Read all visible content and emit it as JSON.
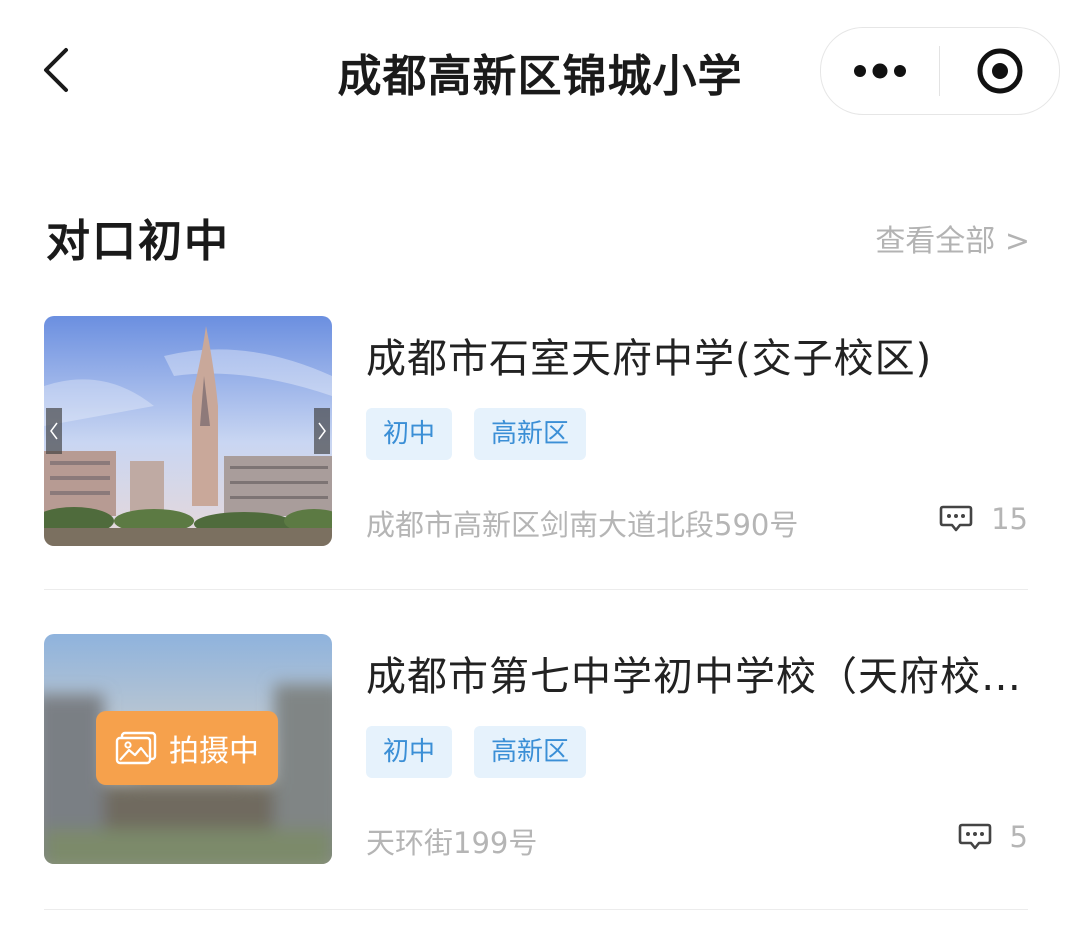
{
  "header": {
    "title": "成都高新区锦城小学",
    "back_icon": "chevron-left-icon",
    "more_icon": "more-dots-icon",
    "target_icon": "target-icon"
  },
  "section": {
    "title": "对口初中",
    "view_all": "查看全部 >"
  },
  "schools": [
    {
      "name": "成都市石室天府中学(交子校区)",
      "tags": [
        "初中",
        "高新区"
      ],
      "address": "成都市高新区剑南大道北段590号",
      "comment_count": "15",
      "photo": "campus-photo"
    },
    {
      "name": "成都市第七中学初中学校（天府校区）",
      "tags": [
        "初中",
        "高新区"
      ],
      "address": "天环街199号",
      "comment_count": "5",
      "photo_status": "拍摄中"
    }
  ],
  "colors": {
    "tag_text": "#3b8fd6",
    "tag_bg": "#e6f2fc",
    "badge_bg": "#f6a14c",
    "muted_text": "#b5b5b5"
  }
}
